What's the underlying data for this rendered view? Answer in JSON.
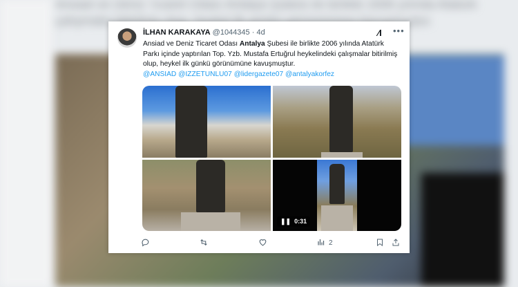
{
  "background": {
    "text_line1": "Ansiad ve Deniz Ticaret Odası Antalya Şubesi ile birlikte 2006 yılında Atatürk",
    "text_line2": "çalışmalar bitirilmiş olup, heykel ilk günkü görünümüne kavuşmuştur."
  },
  "tweet": {
    "author_name": "İLHAN KARAKAYA",
    "handle": "@1044345",
    "separator": "·",
    "time": "4d",
    "text_before_bold": "Ansiad ve Deniz Ticaret Odası ",
    "text_bold": "Antalya",
    "text_after_bold": " Şubesi ile birlikte 2006 yılında Atatürk Parkı içinde yaptırılan Top. Yzb. Mustafa Ertuğrul heykelindeki çalışmalar bitirilmiş olup, heykel ilk günkü görünümüne kavuşmuştur.",
    "mentions": [
      "@ANSIAD",
      "@IZZETUNLU07",
      "@lidergazete07",
      "@antalyakorfez"
    ],
    "video_duration": "0:31",
    "views_count": "2"
  },
  "icons": {
    "xai": "xai-grok-icon",
    "more": "more-dots-icon",
    "reply": "reply-icon",
    "repost": "repost-icon",
    "like": "heart-icon",
    "views": "views-bar-chart-icon",
    "bookmark": "bookmark-icon",
    "share": "share-icon",
    "pause": "pause-icon"
  },
  "colors": {
    "link": "#1d9bf0",
    "text": "#0f1419",
    "muted": "#536471"
  }
}
